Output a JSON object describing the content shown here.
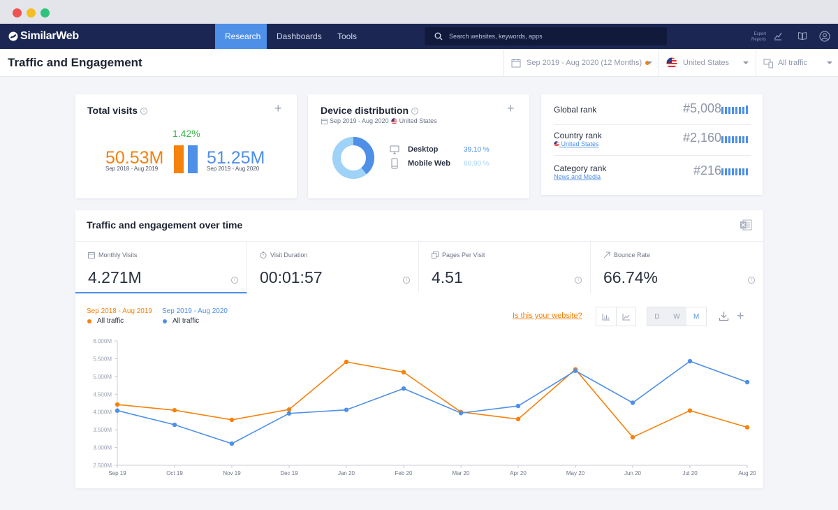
{
  "nav": {
    "brand": "SimilarWeb",
    "items": [
      "Research",
      "Dashboards",
      "Tools"
    ],
    "search_placeholder": "Search websites, keywords, apps",
    "expert_line1": "Expert",
    "expert_line2": "Reports"
  },
  "header": {
    "title": "Traffic and Engagement",
    "date_range": "Sep 2019 - Aug 2020 (12 Months)",
    "country": "United States",
    "traffic": "All traffic"
  },
  "total_visits": {
    "title": "Total visits",
    "change": "1.42%",
    "prev_value": "50.53M",
    "prev_period": "Sep 2018 - Aug 2019",
    "curr_value": "51.25M",
    "curr_period": "Sep 2019 - Aug 2020",
    "prev_color": "#f5820b",
    "curr_color": "#4e8fe8"
  },
  "device": {
    "title": "Device distribution",
    "period": "Sep 2019 - Aug 2020",
    "country": "United States",
    "desktop_label": "Desktop",
    "desktop_value": "39.10 %",
    "desktop_share": 0.391,
    "mobile_label": "Mobile Web",
    "mobile_value": "60.90 %"
  },
  "ranks": {
    "global_label": "Global rank",
    "global_value": "#5,008",
    "country_label": "Country rank",
    "country_sub": "United States",
    "country_value": "#2,160",
    "category_label": "Category rank",
    "category_sub": "News and Media",
    "category_value": "#216"
  },
  "engagement": {
    "title": "Traffic and engagement over time",
    "metrics": [
      {
        "label": "Monthly Visits",
        "value": "4.271M"
      },
      {
        "label": "Visit Duration",
        "value": "00:01:57"
      },
      {
        "label": "Pages Per Visit",
        "value": "4.51"
      },
      {
        "label": "Bounce Rate",
        "value": "66.74%"
      }
    ],
    "legend_prev_period": "Sep 2018 - Aug 2019",
    "legend_curr_period": "Sep 2019 - Aug 2020",
    "legend_prev_label": "All traffic",
    "legend_curr_label": "All traffic",
    "claim_link": "Is this your website?",
    "granularity": [
      "D",
      "W",
      "M"
    ],
    "selected_granularity": "M"
  },
  "chart_data": {
    "type": "line",
    "x": [
      "Sep 19",
      "Oct 19",
      "Nov 19",
      "Dec 19",
      "Jan 20",
      "Feb 20",
      "Mar 20",
      "Apr 20",
      "May 20",
      "Jun 20",
      "Jul 20",
      "Aug 20"
    ],
    "ylim": [
      2.5,
      6.0
    ],
    "y_ticks": [
      "2.500M",
      "3.000M",
      "3.500M",
      "4.000M",
      "4.500M",
      "5.000M",
      "5.500M",
      "6.000M"
    ],
    "series": [
      {
        "name": "All traffic",
        "period": "Sep 2018 - Aug 2019",
        "color": "#f5820b",
        "values": [
          4.21,
          4.05,
          3.78,
          4.07,
          5.41,
          5.12,
          4.0,
          3.8,
          5.2,
          3.29,
          4.04,
          3.57
        ]
      },
      {
        "name": "All traffic",
        "period": "Sep 2019 - Aug 2020",
        "color": "#4e8fe8",
        "values": [
          4.04,
          3.64,
          3.11,
          3.96,
          4.06,
          4.66,
          3.97,
          4.17,
          5.16,
          4.26,
          5.43,
          4.84
        ]
      }
    ],
    "grid": false,
    "legend": "top-left"
  }
}
